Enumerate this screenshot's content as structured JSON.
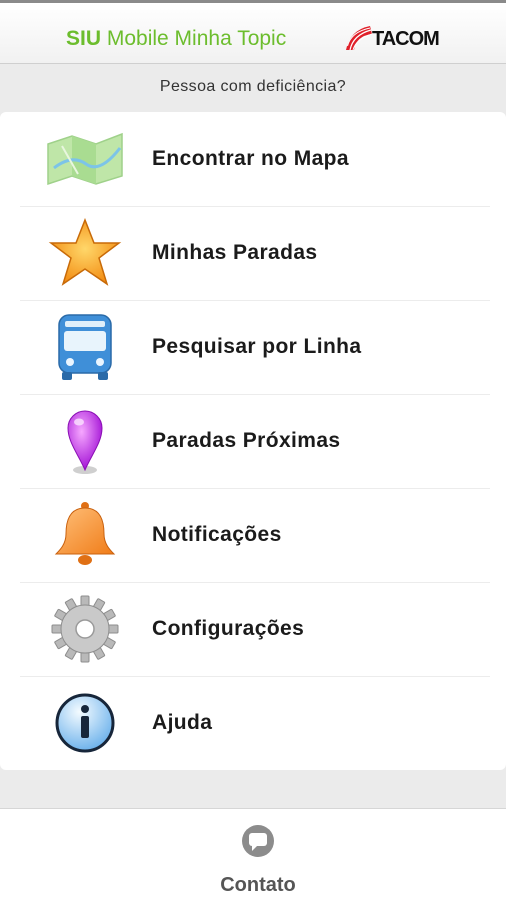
{
  "header": {
    "title_strong": "SIU",
    "title_rest": " Mobile Minha Topic",
    "brand_logo_text": "TACOM"
  },
  "accessibility_link": "Pessoa com deficiência?",
  "menu": {
    "items": [
      {
        "label": "Encontrar no Mapa",
        "icon": "map-icon"
      },
      {
        "label": "Minhas Paradas",
        "icon": "star-icon"
      },
      {
        "label": "Pesquisar por Linha",
        "icon": "bus-icon"
      },
      {
        "label": "Paradas Próximas",
        "icon": "map-pin-icon"
      },
      {
        "label": "Notificações",
        "icon": "bell-icon"
      },
      {
        "label": "Configurações",
        "icon": "gear-icon"
      },
      {
        "label": "Ajuda",
        "icon": "info-icon"
      }
    ]
  },
  "footer": {
    "contact_label": "Contato",
    "contact_icon": "chat-bubble-icon"
  },
  "colors": {
    "brand_green": "#6cbd2d",
    "logo_red": "#e0202a",
    "menu_text": "#1b1b1b"
  }
}
